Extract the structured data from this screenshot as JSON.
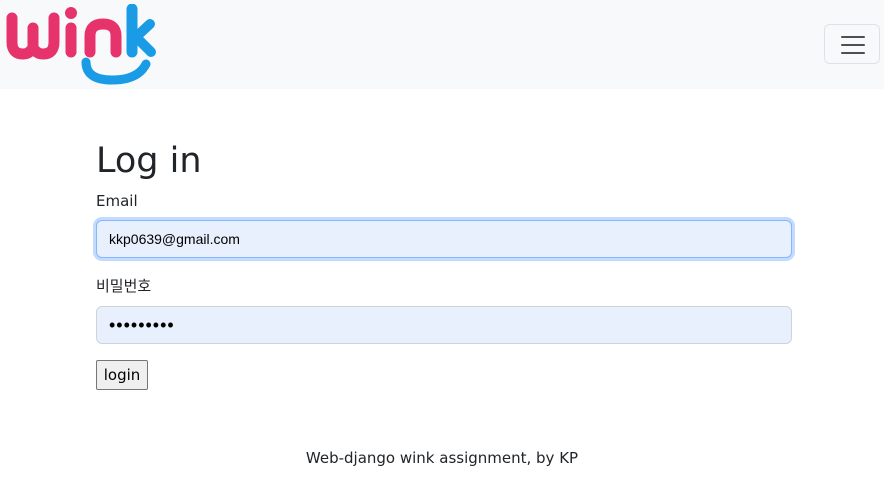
{
  "navbar": {
    "logo_text": "wink",
    "menu_icon": "hamburger-icon"
  },
  "colors": {
    "brand_pink": "#e6336b",
    "brand_blue": "#1a9be6",
    "navbar_bg": "#f8f9fa",
    "input_bg": "#e8f0fe"
  },
  "form": {
    "title": "Log in",
    "email_label": "Email",
    "email_value": "kkp0639@gmail.com",
    "password_label": "비밀번호",
    "password_value": "•••••••••",
    "submit_label": "login"
  },
  "footer": {
    "text": "Web-django wink assignment, by KP"
  }
}
